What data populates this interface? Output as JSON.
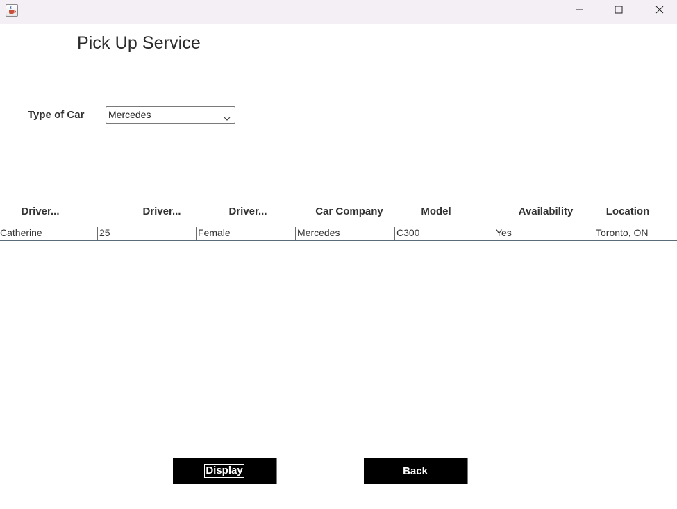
{
  "window": {
    "app_icon": "java-cup-icon",
    "controls": [
      "minimize-icon",
      "maximize-icon",
      "close-icon"
    ]
  },
  "header": {
    "title": "Pick Up Service"
  },
  "filter": {
    "label": "Type of Car",
    "selected": "Mercedes"
  },
  "table": {
    "columns": [
      "Driver...",
      "Driver...",
      "Driver...",
      "Car Company",
      "Model",
      "Availability",
      "Location"
    ],
    "rows": [
      [
        "Catherine",
        "25",
        "Female",
        "Mercedes",
        "C300",
        "Yes",
        "Toronto, ON"
      ]
    ]
  },
  "buttons": {
    "display_label": "Display",
    "back_label": "Back"
  }
}
